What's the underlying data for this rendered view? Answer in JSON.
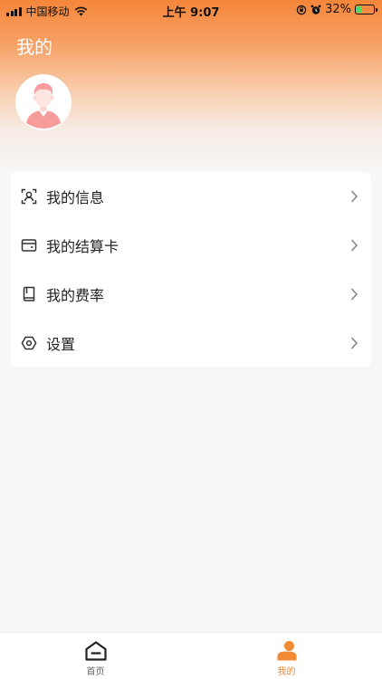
{
  "status_bar": {
    "carrier": "中国移动",
    "time": "上午 9:07",
    "battery_percent": "32%",
    "battery_level": 0.32
  },
  "header": {
    "title": "我的",
    "gradient_color": "#f5863a"
  },
  "menu": {
    "items": [
      {
        "label": "我的信息",
        "icon": "user-scan-icon"
      },
      {
        "label": "我的结算卡",
        "icon": "card-icon"
      },
      {
        "label": "我的费率",
        "icon": "book-icon"
      },
      {
        "label": "设置",
        "icon": "settings-icon"
      }
    ]
  },
  "tabbar": {
    "tabs": [
      {
        "label": "首页",
        "icon": "home-icon",
        "active": false
      },
      {
        "label": "我的",
        "icon": "profile-icon",
        "active": true
      }
    ],
    "active_color": "#f08a34"
  }
}
